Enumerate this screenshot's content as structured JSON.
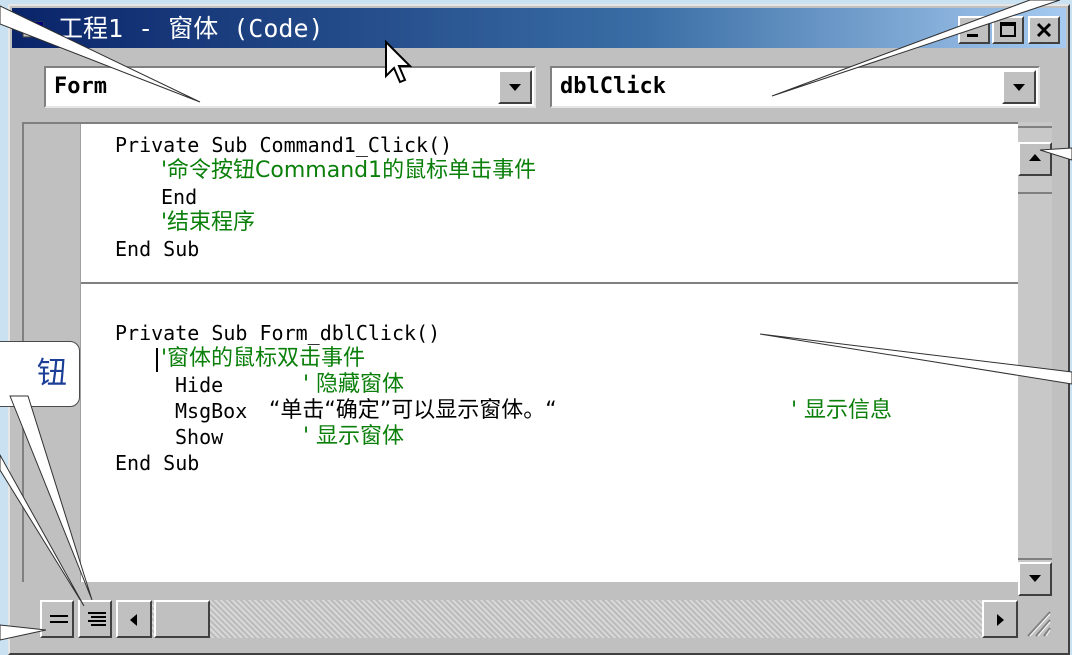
{
  "window": {
    "title": "工程1 - 窗体 (Code)"
  },
  "object_combo": {
    "value": "Form"
  },
  "procedure_combo": {
    "value": "dblClick"
  },
  "code": {
    "block1": {
      "header": "Private Sub Command1_Click()",
      "comment1": "'命令按钮Command1的鼠标单击事件",
      "stmt_end": "End",
      "comment2": "'结束程序",
      "end_sub": "End Sub"
    },
    "block2": {
      "header": "Private Sub Form_dblClick()",
      "comment1": "'窗体的鼠标双击事件",
      "hide_stmt": "Hide",
      "hide_comment": "' 隐藏窗体",
      "msgbox_stmt": "MsgBox",
      "msgbox_string": "“单击“确定”可以显示窗体。“",
      "msgbox_comment": "' 显示信息",
      "show_stmt": "Show",
      "show_comment": "' 显示窗体",
      "end_sub": "End Sub"
    }
  },
  "callout": {
    "text": "钮"
  },
  "colors": {
    "background": "#c9e1f1",
    "comment": "#0a7f0a",
    "titlebar": "#0a246a",
    "callout_text": "#1c3e96"
  },
  "icons": {
    "app": "vb-form-icon",
    "minimize": "minimize-icon",
    "maximize": "maximize-icon",
    "close": "close-icon",
    "procedure_view": "procedure-view-icon",
    "full_module_view": "full-module-view-icon"
  }
}
